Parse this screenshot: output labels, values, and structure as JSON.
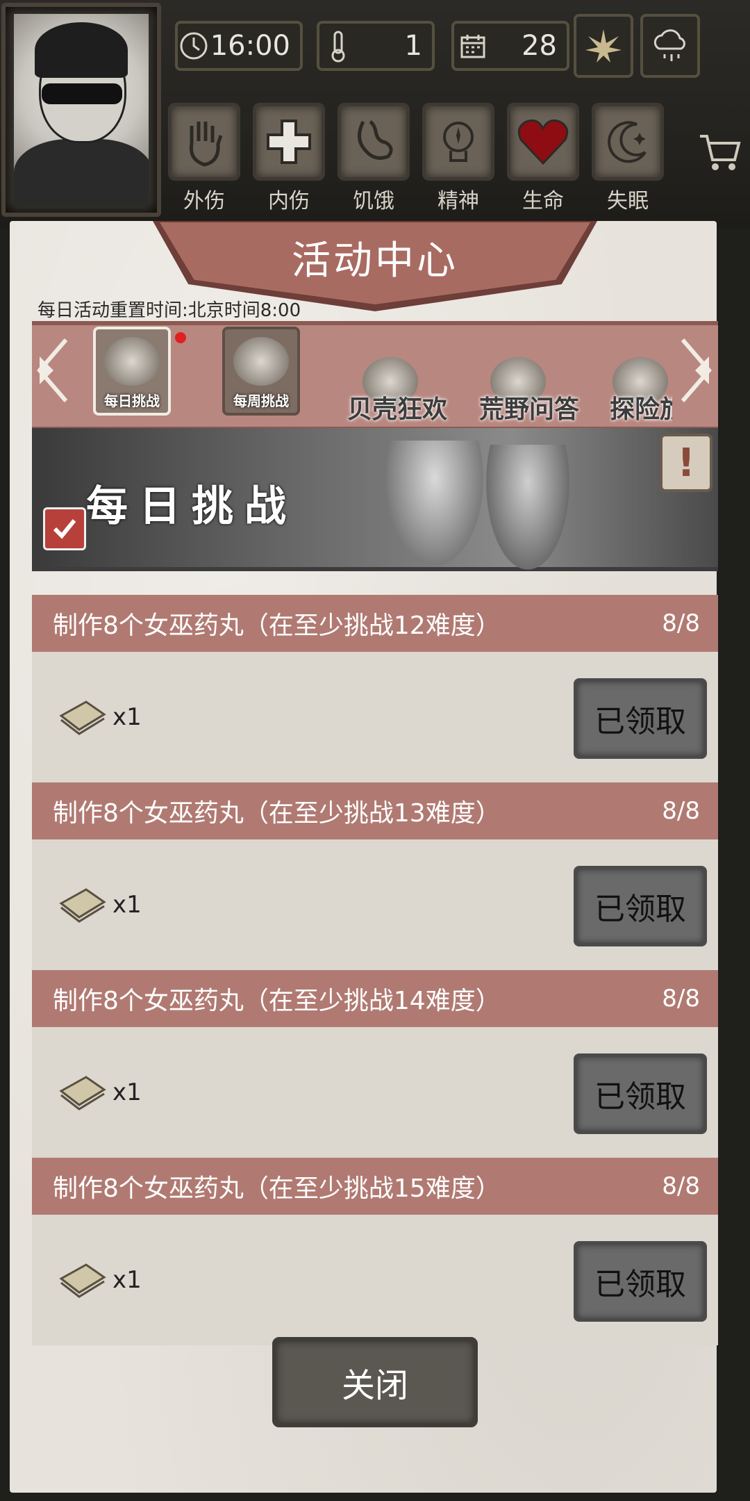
{
  "hud": {
    "time": "16:00",
    "temperature": "1",
    "day": "28",
    "statuses": [
      {
        "icon": "hand-icon",
        "label": "外伤"
      },
      {
        "icon": "cross-icon",
        "label": "内伤"
      },
      {
        "icon": "stomach-icon",
        "label": "饥饿"
      },
      {
        "icon": "brain-icon",
        "label": "精神"
      },
      {
        "icon": "heart-icon",
        "label": "生命"
      },
      {
        "icon": "moon-icon",
        "label": "失眠"
      }
    ]
  },
  "panel": {
    "title": "活动中心",
    "reset_note": "每日活动重置时间:北京时间8:00",
    "tabs": [
      {
        "label": "每日挑战",
        "active": true
      },
      {
        "label": "每周挑战",
        "active": false
      },
      {
        "label": "贝壳狂欢",
        "active": false
      },
      {
        "label": "荒野问答",
        "active": false
      },
      {
        "label": "探险旅",
        "active": false
      }
    ],
    "banner_title": "每日挑战",
    "info_symbol": "!",
    "tasks": [
      {
        "title": "制作8个女巫药丸（在至少挑战12难度）",
        "progress": "8/8",
        "reward_count": "x1",
        "button": "已领取"
      },
      {
        "title": "制作8个女巫药丸（在至少挑战13难度）",
        "progress": "8/8",
        "reward_count": "x1",
        "button": "已领取"
      },
      {
        "title": "制作8个女巫药丸（在至少挑战14难度）",
        "progress": "8/8",
        "reward_count": "x1",
        "button": "已领取"
      },
      {
        "title": "制作8个女巫药丸（在至少挑战15难度）",
        "progress": "8/8",
        "reward_count": "x1",
        "button": "已领取"
      }
    ],
    "close_label": "关闭"
  },
  "colors": {
    "panel_bg": "#e7e3dc",
    "accent_rose": "#b07a72",
    "banner_dark": "#6e3e39",
    "claimed_gray": "#6a6a6a",
    "hud_dark": "#24231f"
  }
}
